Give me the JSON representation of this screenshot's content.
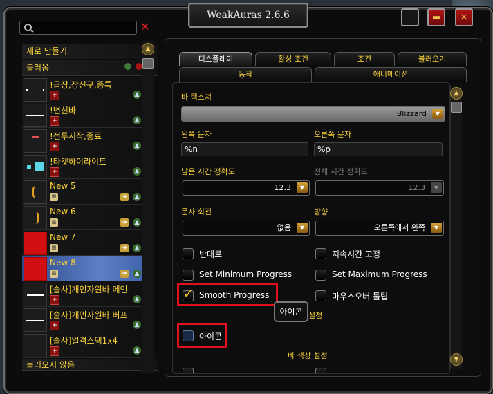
{
  "window": {
    "title": "WeakAuras 2.6.6"
  },
  "search": {
    "placeholder": ""
  },
  "sidebar": {
    "new_label": "새로 만들기",
    "loaded_label": "불러옴",
    "unloaded_label": "불러오지 않음",
    "items": [
      {
        "label": "!급장,장신구,종특"
      },
      {
        "label": "!변신바"
      },
      {
        "label": "!전투시작,종료"
      },
      {
        "label": "!타겟하이라이트"
      },
      {
        "label": "New 5"
      },
      {
        "label": "New 6"
      },
      {
        "label": "New 7"
      },
      {
        "label": "New 8"
      },
      {
        "label": "[술사]개인자원바 메인"
      },
      {
        "label": "[술사]개인자원바 버프"
      },
      {
        "label": "[술사]얼격스택1x4"
      }
    ]
  },
  "tabs": {
    "display": "디스플레이",
    "activation": "활성 조건",
    "conditions": "조건",
    "load": "불러오기",
    "actions": "동작",
    "animation": "애니메이션"
  },
  "form": {
    "bar_texture_label": "바 텍스쳐",
    "bar_texture_value": "Blizzard",
    "left_text_label": "왼쪽 문자",
    "left_text_value": "%n",
    "right_text_label": "오른쪽 문자",
    "right_text_value": "%p",
    "remaining_precision_label": "남은 시간 정확도",
    "remaining_precision_value": "12.3",
    "total_precision_label": "전체 시간 정확도",
    "total_precision_value": "12.3",
    "text_rotation_label": "문자 회전",
    "text_rotation_value": "없음",
    "orientation_label": "방향",
    "orientation_value": "오른쪽에서 왼쪽",
    "inverse_label": "반대로",
    "fixed_duration_label": "지속시간 고정",
    "set_min_label": "Set Minimum Progress",
    "set_max_label": "Set Maximum Progress",
    "smooth_label": "Smooth Progress",
    "mouseover_tooltip_label": "마우스오버 툴팁",
    "icon_settings_heading": "설정",
    "icon_tooltip": "아이콘",
    "icon_label": "아이콘",
    "bar_color_heading": "바 색상 설정"
  }
}
